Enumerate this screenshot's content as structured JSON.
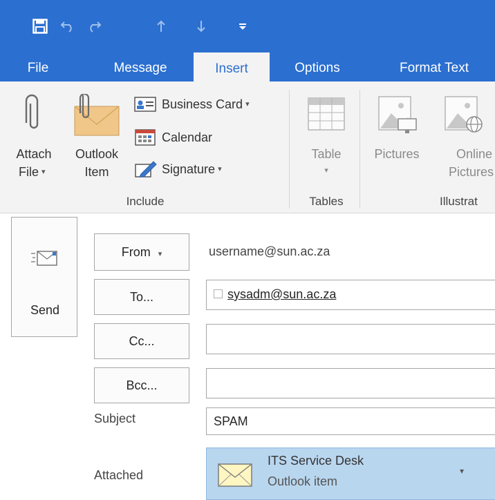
{
  "tabs": [
    {
      "label": "File",
      "active": false
    },
    {
      "label": "Message",
      "active": false
    },
    {
      "label": "Insert",
      "active": true
    },
    {
      "label": "Options",
      "active": false
    },
    {
      "label": "Format Text",
      "active": false
    }
  ],
  "ribbon": {
    "attach_file": {
      "line1": "Attach",
      "line2": "File"
    },
    "outlook_item": {
      "line1": "Outlook",
      "line2": "Item"
    },
    "business_card": "Business Card",
    "calendar": "Calendar",
    "signature": "Signature",
    "include_group": "Include",
    "table": "Table",
    "tables_group": "Tables",
    "pictures": "Pictures",
    "online_pictures": {
      "line1": "Online",
      "line2": "Pictures"
    },
    "illustrations_group": "Illustrat"
  },
  "compose": {
    "send_label": "Send",
    "from_label": "From",
    "from_value": "username@sun.ac.za",
    "to_label": "To...",
    "to_recipient": "sysadm@sun.ac.za",
    "cc_label": "Cc...",
    "bcc_label": "Bcc...",
    "subject_label": "Subject",
    "subject_value": "SPAM",
    "attached_label": "Attached",
    "attachment_name": "ITS Service Desk",
    "attachment_type": "Outlook item"
  },
  "colors": {
    "accent": "#2b6fd0",
    "ribbon_bg": "#f3f3f3",
    "attachment_bg": "#b9d6ef"
  }
}
